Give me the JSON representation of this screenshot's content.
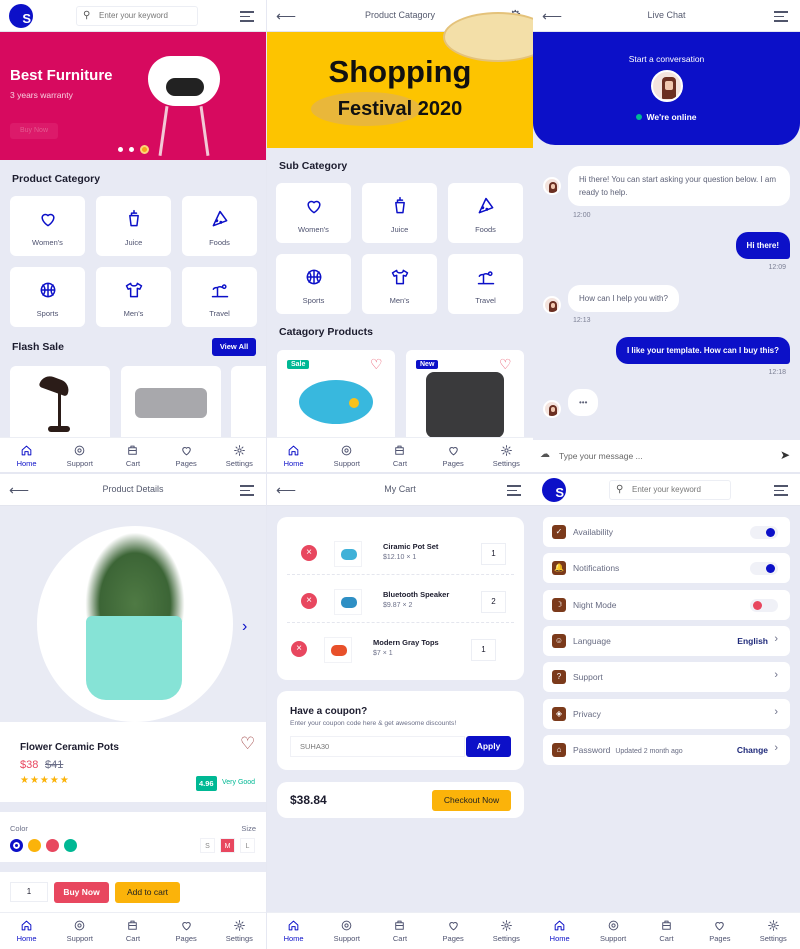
{
  "colors": {
    "primary": "#0c10c8",
    "danger": "#e8475f",
    "warning": "#fbb30a",
    "success": "#00b894",
    "banner_pink": "#d70a5f",
    "banner_yellow": "#fdc400"
  },
  "nav": [
    {
      "label": "Home",
      "icon": "home-icon"
    },
    {
      "label": "Support",
      "icon": "support-icon"
    },
    {
      "label": "Cart",
      "icon": "cart-icon"
    },
    {
      "label": "Pages",
      "icon": "heart-icon"
    },
    {
      "label": "Settings",
      "icon": "gear-icon"
    }
  ],
  "home": {
    "logo": "S",
    "search_placeholder": "Enter your keyword",
    "banner": {
      "title": "Best Furniture",
      "subtitle": "3 years warranty",
      "button": "Buy Now"
    },
    "section_category": "Product Category",
    "categories": [
      {
        "label": "Women's",
        "icon": "heart"
      },
      {
        "label": "Juice",
        "icon": "cup"
      },
      {
        "label": "Foods",
        "icon": "pizza"
      },
      {
        "label": "Sports",
        "icon": "ball"
      },
      {
        "label": "Men's",
        "icon": "shirt"
      },
      {
        "label": "Travel",
        "icon": "travel"
      }
    ],
    "flash_sale": "Flash Sale",
    "view_all": "View All"
  },
  "catalog": {
    "title": "Product Catagory",
    "banner": {
      "line1": "Shopping",
      "line2": "Festival 2020"
    },
    "sub_category": "Sub Category",
    "categories": [
      {
        "label": "Women's",
        "icon": "heart"
      },
      {
        "label": "Juice",
        "icon": "cup"
      },
      {
        "label": "Foods",
        "icon": "pizza"
      },
      {
        "label": "Sports",
        "icon": "ball"
      },
      {
        "label": "Men's",
        "icon": "shirt"
      },
      {
        "label": "Travel",
        "icon": "travel"
      }
    ],
    "products_title": "Catagory Products",
    "products": [
      {
        "badge": "Sale",
        "badge_color": "#00b894"
      },
      {
        "badge": "New",
        "badge_color": "#0c10c8"
      }
    ]
  },
  "chat": {
    "title": "Live Chat",
    "start": "Start a conversation",
    "status": "We're online",
    "messages": [
      {
        "from": "agent",
        "text": "Hi there! You can start asking your question below. I am ready to help.",
        "time": "12:00"
      },
      {
        "from": "user",
        "text": "Hi there!",
        "time": "12:09"
      },
      {
        "from": "agent",
        "text": "How can I help you with?",
        "time": "12:13"
      },
      {
        "from": "user",
        "text": "I like your template. How can I buy this?",
        "time": "12:18"
      },
      {
        "from": "agent",
        "text": "•••",
        "time": ""
      }
    ],
    "input_placeholder": "Type your message ..."
  },
  "details": {
    "title": "Product Details",
    "name": "Flower Ceramic Pots",
    "price": "$38",
    "old_price": "$41",
    "stars": 5,
    "rating": "4.96",
    "rating_text": "Very Good",
    "color_label": "Color",
    "colors": [
      "#0c10c8",
      "#fbb30a",
      "#e8475f",
      "#00b894"
    ],
    "size_label": "Size",
    "sizes": [
      "S",
      "M",
      "L"
    ],
    "selected_size": "M",
    "quantity": "1",
    "buy_now": "Buy Now",
    "add_to_cart": "Add to cart"
  },
  "cart": {
    "title": "My Cart",
    "items": [
      {
        "name": "Ciramic Pot Set",
        "price": "$12.10 × 1",
        "qty": "1"
      },
      {
        "name": "Bluetooth Speaker",
        "price": "$9.87 × 2",
        "qty": "2"
      },
      {
        "name": "Modern Gray Tops",
        "price": "$7 × 1",
        "qty": "1"
      }
    ],
    "coupon_title": "Have a coupon?",
    "coupon_desc": "Enter your coupon code here & get awesome discounts!",
    "coupon_value": "SUHA30",
    "apply": "Apply",
    "total": "$38.84",
    "checkout": "Checkout Now"
  },
  "settings": {
    "search_placeholder": "Enter your keyword",
    "items": [
      {
        "label": "Availability",
        "icon": "✓",
        "type": "toggle",
        "on": true
      },
      {
        "label": "Notifications",
        "icon": "🔔",
        "type": "toggle",
        "on": true
      },
      {
        "label": "Night Mode",
        "icon": "☽",
        "type": "toggle",
        "on": false
      },
      {
        "label": "Language",
        "icon": "☺",
        "type": "link",
        "value": "English"
      },
      {
        "label": "Support",
        "icon": "?",
        "type": "link",
        "value": ""
      },
      {
        "label": "Privacy",
        "icon": "◈",
        "type": "link",
        "value": ""
      },
      {
        "label": "Password",
        "note": "Updated 2 month ago",
        "icon": "⌂",
        "type": "link",
        "value": "Change"
      }
    ]
  }
}
